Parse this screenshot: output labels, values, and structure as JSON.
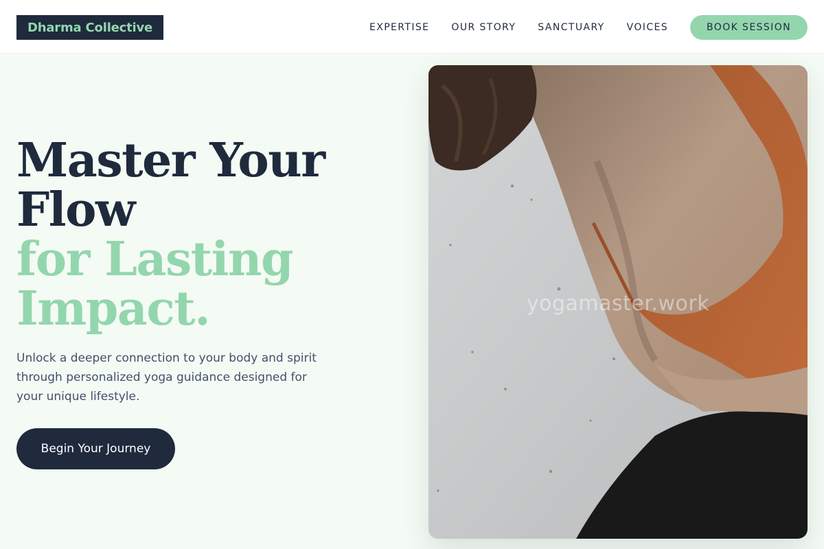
{
  "brand": {
    "name": "Dharma Collective"
  },
  "nav": {
    "items": [
      {
        "label": "EXPERTISE"
      },
      {
        "label": "OUR STORY"
      },
      {
        "label": "SANCTUARY"
      },
      {
        "label": "VOICES"
      }
    ],
    "cta_label": "BOOK SESSION"
  },
  "hero": {
    "title_line1": "Master Your",
    "title_line2": "Flow",
    "title_accent_line1": "for Lasting",
    "title_accent_line2": "Impact.",
    "description": "Unlock a deeper connection to your body and spirit through personalized yoga guidance designed for your unique lifestyle.",
    "button_label": "Begin Your Journey",
    "image_watermark": "yogamaster.work"
  },
  "colors": {
    "navy": "#1f2a3d",
    "mint": "#93d6ad",
    "page_bg": "#f4fbf4",
    "body_text": "#43506a"
  }
}
